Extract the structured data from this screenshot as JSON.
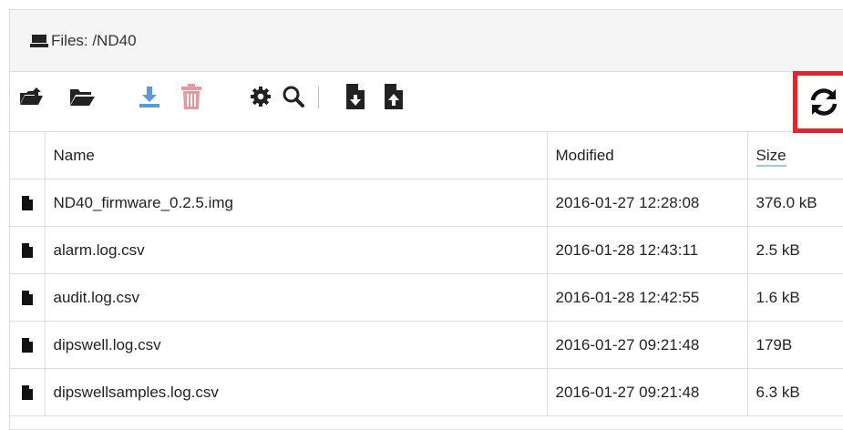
{
  "header": {
    "title": "Files: /ND40"
  },
  "toolbar": {
    "buttons": [
      {
        "name": "upload-folder-button",
        "icon": "folder-open-upload-icon"
      },
      {
        "name": "open-folder-button",
        "icon": "folder-open-icon"
      },
      {
        "name": "download-button",
        "icon": "download-icon",
        "color": "#5b9bd5"
      },
      {
        "name": "delete-button",
        "icon": "trash-icon",
        "color": "#e8989c"
      },
      {
        "name": "settings-button",
        "icon": "gear-icon"
      },
      {
        "name": "search-button",
        "icon": "search-icon"
      },
      {
        "name": "file-download-button",
        "icon": "file-download-icon"
      },
      {
        "name": "file-upload-button",
        "icon": "file-upload-icon"
      }
    ],
    "refresh": {
      "icon": "refresh-icon",
      "highlight_color": "#e0262e"
    }
  },
  "table": {
    "columns": [
      "",
      "Name",
      "Modified",
      "Size"
    ],
    "rows": [
      {
        "name": "ND40_firmware_0.2.5.img",
        "modified": "2016-01-27 12:28:08",
        "size": "376.0 kB"
      },
      {
        "name": "alarm.log.csv",
        "modified": "2016-01-28 12:43:11",
        "size": "2.5 kB"
      },
      {
        "name": "audit.log.csv",
        "modified": "2016-01-28 12:42:55",
        "size": "1.6 kB"
      },
      {
        "name": "dipswell.log.csv",
        "modified": "2016-01-27 09:21:48",
        "size": "179B"
      },
      {
        "name": "dipswellsamples.log.csv",
        "modified": "2016-01-27 09:21:48",
        "size": "6.3 kB"
      }
    ]
  }
}
